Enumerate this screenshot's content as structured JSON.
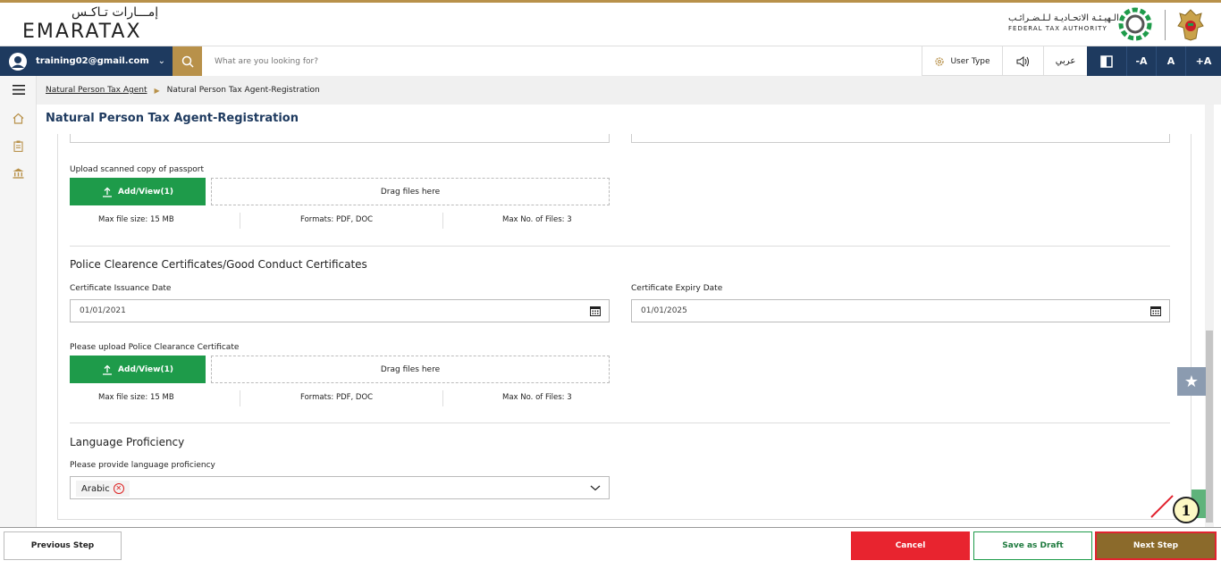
{
  "header": {
    "logo_ar": "إمـــارات تـاكـس",
    "logo_en": "EMARATAX",
    "fta_ar": "الـهيـئـة الاتحـاديـة لـلـضـرائـب",
    "fta_en": "FEDERAL TAX AUTHORITY"
  },
  "navbar": {
    "email": "training02@gmail.com",
    "search_placeholder": "What are you looking for?",
    "user_type": "User Type",
    "arabic": "عربي",
    "font_decrease": "-A",
    "font_normal": "A",
    "font_increase": "+A"
  },
  "breadcrumb": {
    "parent": "Natural Person Tax Agent",
    "current": "Natural Person Tax Agent-Registration"
  },
  "page_title": "Natural Person Tax Agent-Registration",
  "passport_upload": {
    "label": "Upload scanned copy of passport",
    "button": "Add/View(1)",
    "drop": "Drag files here",
    "max_size": "Max file size: 15 MB",
    "formats": "Formats: PDF, DOC",
    "max_files": "Max No. of Files: 3"
  },
  "police": {
    "title": "Police Clearence Certificates/Good Conduct Certificates",
    "issuance_label": "Certificate Issuance Date",
    "issuance_value": "01/01/2021",
    "expiry_label": "Certificate Expiry Date",
    "expiry_value": "01/01/2025",
    "upload_label": "Please upload Police Clearance Certificate",
    "button": "Add/View(1)",
    "drop": "Drag files here",
    "max_size": "Max file size: 15 MB",
    "formats": "Formats: PDF, DOC",
    "max_files": "Max No. of Files: 3"
  },
  "language": {
    "title": "Language Proficiency",
    "label": "Please provide language proficiency",
    "chip": "Arabic"
  },
  "footer": {
    "previous": "Previous Step",
    "cancel": "Cancel",
    "draft": "Save as Draft",
    "next": "Next Step"
  },
  "annotation": {
    "marker": "1"
  },
  "colors": {
    "navy": "#1e3a5f",
    "gold": "#b8914a",
    "green": "#1e9b4a",
    "red": "#e8242f",
    "next_bg": "#8b6a2b"
  }
}
